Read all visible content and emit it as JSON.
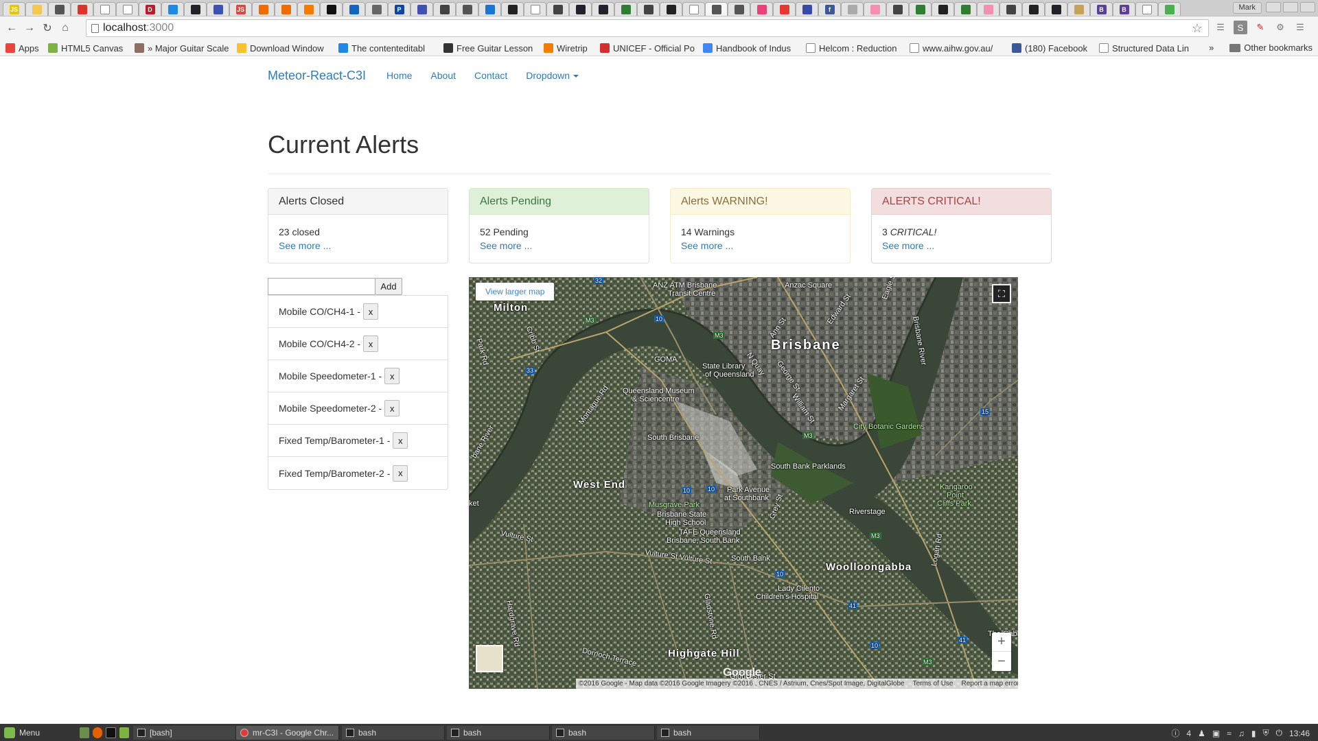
{
  "browser": {
    "url_host": "localhost",
    "url_port": ":3000",
    "window_user": "Mark",
    "tabs": [
      {
        "icon": "js-icon",
        "color": "#e6c800",
        "glyph": "JS"
      },
      {
        "icon": "bulb-icon",
        "color": "#f2c94c",
        "glyph": ""
      },
      {
        "icon": "gauge-icon",
        "color": "#555555",
        "glyph": ""
      },
      {
        "icon": "badge-icon",
        "color": "#d9352b",
        "glyph": ""
      },
      {
        "icon": "page-icon",
        "color": "#ffffff",
        "glyph": ""
      },
      {
        "icon": "page-icon",
        "color": "#ffffff",
        "glyph": ""
      },
      {
        "icon": "d-icon",
        "color": "#c0182d",
        "glyph": "D"
      },
      {
        "icon": "shield-icon",
        "color": "#1e88e5",
        "glyph": ""
      },
      {
        "icon": "react-icon",
        "color": "#20232a",
        "glyph": ""
      },
      {
        "icon": "link-icon",
        "color": "#3f51b5",
        "glyph": ""
      },
      {
        "icon": "js-red-icon",
        "color": "#e0443e",
        "glyph": "JS"
      },
      {
        "icon": "search-icon",
        "color": "#ef6c00",
        "glyph": ""
      },
      {
        "icon": "search-icon",
        "color": "#ef6c00",
        "glyph": ""
      },
      {
        "icon": "arrow-icon",
        "color": "#f57c00",
        "glyph": ""
      },
      {
        "icon": "codepen-icon",
        "color": "#111111",
        "glyph": ""
      },
      {
        "icon": "html5-icon",
        "color": "#1565c0",
        "glyph": ""
      },
      {
        "icon": "book-icon",
        "color": "#666666",
        "glyph": ""
      },
      {
        "icon": "p-icon",
        "color": "#0d47a1",
        "glyph": "P"
      },
      {
        "icon": "link-icon",
        "color": "#3f51b5",
        "glyph": ""
      },
      {
        "icon": "code-icon",
        "color": "#444444",
        "glyph": ""
      },
      {
        "icon": "x-icon",
        "color": "#555555",
        "glyph": ""
      },
      {
        "icon": "blogger-icon",
        "color": "#1976d2",
        "glyph": ""
      },
      {
        "icon": "github-icon",
        "color": "#222222",
        "glyph": ""
      },
      {
        "icon": "page-icon",
        "color": "#ffffff",
        "glyph": ""
      },
      {
        "icon": "feather-icon",
        "color": "#444444",
        "glyph": ""
      },
      {
        "icon": "react-icon",
        "color": "#20232a",
        "glyph": ""
      },
      {
        "icon": "react-icon",
        "color": "#20232a",
        "glyph": ""
      },
      {
        "icon": "terminal-icon",
        "color": "#2e7d32",
        "glyph": ""
      },
      {
        "icon": "feather-icon",
        "color": "#444444",
        "glyph": ""
      },
      {
        "icon": "github-icon",
        "color": "#222222",
        "glyph": ""
      },
      {
        "icon": "page-icon",
        "color": "#ffffff",
        "glyph": ""
      },
      {
        "icon": "close-icon",
        "color": "#555555",
        "glyph": ""
      },
      {
        "icon": "diamond-icon",
        "color": "#555555",
        "glyph": ""
      },
      {
        "icon": "yarn-icon",
        "color": "#ec407a",
        "glyph": ""
      },
      {
        "icon": "puzzle-icon",
        "color": "#e53935",
        "glyph": ""
      },
      {
        "icon": "mail-icon",
        "color": "#3949ab",
        "glyph": ""
      },
      {
        "icon": "facebook-icon",
        "color": "#3b5998",
        "glyph": "f"
      },
      {
        "icon": "image-icon",
        "color": "#aaaaaa",
        "glyph": ""
      },
      {
        "icon": "pill-icon",
        "color": "#f48fb1",
        "glyph": ""
      },
      {
        "icon": "code-icon",
        "color": "#444444",
        "glyph": ""
      },
      {
        "icon": "terminal-icon",
        "color": "#2e7d32",
        "glyph": ""
      },
      {
        "icon": "github-icon",
        "color": "#222222",
        "glyph": ""
      },
      {
        "icon": "terminal-icon",
        "color": "#2e7d32",
        "glyph": ""
      },
      {
        "icon": "pill-icon",
        "color": "#f48fb1",
        "glyph": ""
      },
      {
        "icon": "feather-icon",
        "color": "#444444",
        "glyph": ""
      },
      {
        "icon": "github-icon",
        "color": "#222222",
        "glyph": ""
      },
      {
        "icon": "react-icon",
        "color": "#20232a",
        "glyph": ""
      },
      {
        "icon": "gear-icon",
        "color": "#c5a35a",
        "glyph": ""
      },
      {
        "icon": "b-icon",
        "color": "#5c3d99",
        "glyph": "B"
      },
      {
        "icon": "b-icon",
        "color": "#5c3d99",
        "glyph": "B"
      },
      {
        "icon": "page-icon",
        "color": "#ffffff",
        "glyph": ""
      },
      {
        "icon": "map-icon",
        "color": "#4caf50",
        "glyph": ""
      }
    ],
    "bookmarks": [
      {
        "label": "Apps",
        "icon": "apps-grid-icon",
        "color": "#e8453c"
      },
      {
        "label": "HTML5 Canvas",
        "icon": "canvas-icon",
        "color": "#7cb342"
      },
      {
        "label": "» Major Guitar Scale",
        "icon": "guitar-icon",
        "color": "#8d6e63"
      },
      {
        "label": "Download Window",
        "icon": "bulb-icon",
        "color": "#fbc02d"
      },
      {
        "label": "The contenteditabl",
        "icon": "site-icon",
        "color": "#1e88e5"
      },
      {
        "label": "Free Guitar Lesson",
        "icon": "guitar-icon",
        "color": "#333333"
      },
      {
        "label": "Wiretrip",
        "icon": "blogger-icon",
        "color": "#f57c00"
      },
      {
        "label": "UNICEF - Official Po",
        "icon": "unicef-icon",
        "color": "#d32f2f"
      },
      {
        "label": "Handbook of Indus",
        "icon": "google-icon",
        "color": "#4285f4"
      },
      {
        "label": "Helcom : Reduction",
        "icon": "page-icon",
        "color": "#ffffff"
      },
      {
        "label": "www.aihw.gov.au/",
        "icon": "page-icon",
        "color": "#ffffff"
      },
      {
        "label": "(180) Facebook",
        "icon": "facebook-icon",
        "color": "#3b5998"
      },
      {
        "label": "Structured Data Lin",
        "icon": "page-icon",
        "color": "#ffffff"
      }
    ],
    "bookmarks_more": "»",
    "other_bookmarks": "Other bookmarks"
  },
  "nav": {
    "brand": "Meteor-React-C3I",
    "links": [
      "Home",
      "About",
      "Contact"
    ],
    "dropdown": "Dropdown"
  },
  "page": {
    "title": "Current Alerts"
  },
  "panels": [
    {
      "heading": "Alerts Closed",
      "count_text": "23 closed",
      "link": "See more ...",
      "style": "default"
    },
    {
      "heading": "Alerts Pending",
      "count_text": "52 Pending",
      "link": "See more ...",
      "style": "success"
    },
    {
      "heading": "Alerts WARNING!",
      "count_text": "14 Warnings",
      "link": "See more ...",
      "style": "warning"
    },
    {
      "heading": "ALERTS CRITICAL!",
      "count_text": "3 ",
      "count_emph": "CRITICAL!",
      "link": "See more ...",
      "style": "danger"
    }
  ],
  "sensors": {
    "input_value": "",
    "add_label": "Add",
    "remove_label": "x",
    "items": [
      "Mobile CO/CH4-1 -",
      "Mobile CO/CH4-2 -",
      "Mobile Speedometer-1 -",
      "Mobile Speedometer-2 -",
      "Fixed Temp/Barometer-1 -",
      "Fixed Temp/Barometer-2 -"
    ]
  },
  "map": {
    "view_larger": "View larger map",
    "zoom_in": "+",
    "zoom_out": "−",
    "logo": "Google",
    "attribution": "©2016 Google - Map data ©2016 Google Imagery ©2016 , CNES / Astrium, Cnes/Spot Image, DigitalGlobe",
    "terms": "Terms of Use",
    "report": "Report a map error",
    "labels": {
      "brisbane": "Brisbane",
      "milton": "Milton",
      "west_end": "West End",
      "woolloongabba": "Woolloongabba",
      "highgate_hill": "Highgate Hill",
      "anzac_atm": "ANZ ATM Brisbane",
      "transit_centre": "Transit Centre",
      "anzac_square": "Anzac Square",
      "goma": "GOMA",
      "state_library": "State Library",
      "of_queensland": "of Queensland",
      "qld_museum": "Queensland Museum",
      "sciencentre": "& Sciencentre",
      "south_brisbane": "South Brisbane",
      "south_bank_parklands": "South Bank Parklands",
      "city_botanic": "City Botanic Gardens",
      "park_avenue": "Park Avenue",
      "at_southbank": "at Southbank",
      "musgrave_park": "Musgrave Park",
      "bsh_school_1": "Brisbane State",
      "bsh_school_2": "High School",
      "tafe_1": "TAFE Queensland",
      "tafe_2": "Brisbane, South Bank",
      "riverstage": "Riverstage",
      "kangaroo_1": "Kangaroo",
      "kangaroo_2": "Point",
      "kangaroo_3": "Cliffs Park",
      "south_bank": "South Bank",
      "lady_cilento_1": "Lady Cilento",
      "lady_cilento_2": "Children's Hospital",
      "brisbane_river": "Brisbane River",
      "vulture_st": "Vulture St",
      "vulture_st2": "Vulture St  Vulture St",
      "dornoch": "Dornoch Terrace",
      "hardgrave": "Hardgrave Rd",
      "montague": "Montague Rd",
      "cribb": "Cribb St",
      "park_rd": "Park Rd",
      "n_quay": "N Quay",
      "george_st": "George St",
      "william_st": "William St",
      "margaret_st": "Margaret St",
      "edward_st": "Edward St",
      "ann_st": "Ann St",
      "eagle_st": "Eagle St",
      "grey_st": "Grey St",
      "gladstone": "Gladstone Rd",
      "logan": "Logan Rd",
      "the_gabba": "The Gabba",
      "m3": "M3",
      "n10": "10",
      "n15": "15",
      "n32": "32",
      "n33": "33",
      "n41": "41",
      "bane_river": "bane River",
      "ket": "ket",
      "gloucester": "Gloucester St"
    }
  },
  "taskbar": {
    "menu": "Menu",
    "tasks": [
      {
        "label": "[bash]",
        "active": false
      },
      {
        "label": "mr-C3I - Google Chr...",
        "active": true
      },
      {
        "label": "bash",
        "active": false
      },
      {
        "label": "bash",
        "active": false
      },
      {
        "label": "bash",
        "active": false
      },
      {
        "label": "bash",
        "active": false
      }
    ],
    "tray_count": "4",
    "clock": "13:46"
  }
}
